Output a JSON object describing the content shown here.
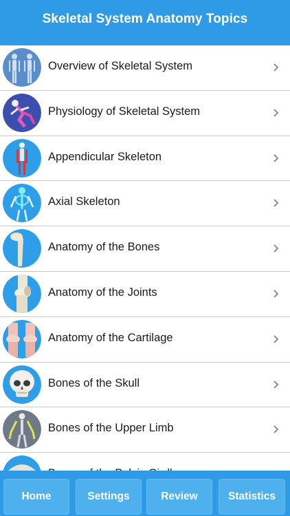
{
  "header": {
    "title": "Skeletal System Anatomy Topics"
  },
  "topics": [
    {
      "label": "Overview of Skeletal System",
      "icon": "skeleton-overview-icon",
      "bg": "#5a8ec9"
    },
    {
      "label": "Physiology of Skeletal System",
      "icon": "running-skeleton-icon",
      "bg": "#3c4fb0"
    },
    {
      "label": "Appendicular Skeleton",
      "icon": "appendicular-skeleton-icon",
      "bg": "#2e9ee8"
    },
    {
      "label": "Axial Skeleton",
      "icon": "axial-skeleton-icon",
      "bg": "#2e9ee8"
    },
    {
      "label": "Anatomy of the Bones",
      "icon": "bone-icon",
      "bg": "#2e9ee8"
    },
    {
      "label": "Anatomy of the Joints",
      "icon": "knee-joint-icon",
      "bg": "#2e9ee8"
    },
    {
      "label": "Anatomy of the Cartilage",
      "icon": "cartilage-icon",
      "bg": "#2e9ee8"
    },
    {
      "label": "Bones of the Skull",
      "icon": "skull-icon",
      "bg": "#2e9ee8"
    },
    {
      "label": "Bones of the Upper Limb",
      "icon": "upper-limb-icon",
      "bg": "#6f7a88"
    },
    {
      "label": "Bones of the Pelvic Girdle",
      "icon": "pelvic-girdle-icon",
      "bg": "#2e9ee8"
    }
  ],
  "tabs": {
    "home": "Home",
    "settings": "Settings",
    "review": "Review",
    "statistics": "Statistics"
  },
  "colors": {
    "header": "#2f9be6",
    "tab_button": "#4fb0ee",
    "divider": "#c8c8cc",
    "chevron": "#8e8e93"
  }
}
